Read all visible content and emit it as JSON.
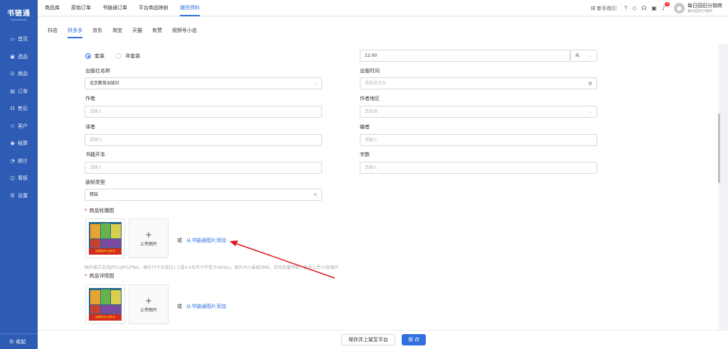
{
  "app": {
    "logo": "书链通",
    "logo_sub": "SHULIANTONG"
  },
  "sidebar": {
    "items": [
      {
        "icon": "monitor-icon",
        "glyph": "▭",
        "label": "首页"
      },
      {
        "icon": "select-icon",
        "glyph": "▣",
        "label": "选品"
      },
      {
        "icon": "product-icon",
        "glyph": "⊡",
        "label": "商品"
      },
      {
        "icon": "order-icon",
        "glyph": "▤",
        "label": "订单"
      },
      {
        "icon": "headset-icon",
        "glyph": "☊",
        "label": "售后"
      },
      {
        "icon": "customer-icon",
        "glyph": "⚇",
        "label": "客户"
      },
      {
        "icon": "settlement-icon",
        "glyph": "◉",
        "label": "结算"
      },
      {
        "icon": "stats-icon",
        "glyph": "◔",
        "label": "统计"
      },
      {
        "icon": "board-icon",
        "glyph": "◫",
        "label": "看板"
      },
      {
        "icon": "settings-icon",
        "glyph": "☰",
        "label": "设置"
      }
    ],
    "collapse_label": "收起"
  },
  "header": {
    "tabs": [
      "商品库",
      "原始订单",
      "书链通订单",
      "平台商品映射",
      "铺货资料"
    ],
    "active_tab": "铺货资料",
    "guide_label": "新手指引",
    "badge_count": "9",
    "user_name": "每日园旧分销商",
    "user_sub": "每日园旧分销商"
  },
  "subtabs": {
    "items": [
      "抖店",
      "拼多多",
      "京东",
      "淘宝",
      "天猫",
      "有赞",
      "视频号小店"
    ],
    "active": "拼多多"
  },
  "form": {
    "radio_set": "套装",
    "radio_nonset": "非套装",
    "price_value": "12.00",
    "price_unit": "元",
    "publisher_label": "出版社名称",
    "publisher_value": "北京教育出版社",
    "pubtime_label": "出版时间",
    "pubtime_placeholder": "请选择月份",
    "author_label": "作者",
    "author_placeholder": "请输入",
    "author_region_label": "作者地区",
    "author_region_placeholder": "请选择",
    "translator_label": "译者",
    "translator_placeholder": "请输入",
    "editor_label": "编者",
    "editor_placeholder": "请输入",
    "format_label": "书籍开本",
    "format_placeholder": "请输入",
    "wordcount_label": "字数",
    "wordcount_placeholder": "请输入",
    "binding_label": "装帧类型",
    "binding_value": "精装",
    "carousel_label": "商品轮播图",
    "detail_label": "商品详情图",
    "upload_label": "上传图片",
    "or_label": "或",
    "add_from_lib": "从书链通图片添加",
    "image_hint": "图片格式支持JPEG/JPG/PNG、图片尺寸长宽比1:1或3:4且尺寸不低于480px，图片大小最高3MB，支持批量传图，最多上传10张图片",
    "cover_caption": "每周精讲小说系列"
  },
  "footer": {
    "save_publish": "保存并上架至平台",
    "save": "保 存"
  },
  "colors": {
    "sidebar": "#2e5bb4",
    "accent": "#2f6fe0",
    "arrow": "#e0151b"
  }
}
